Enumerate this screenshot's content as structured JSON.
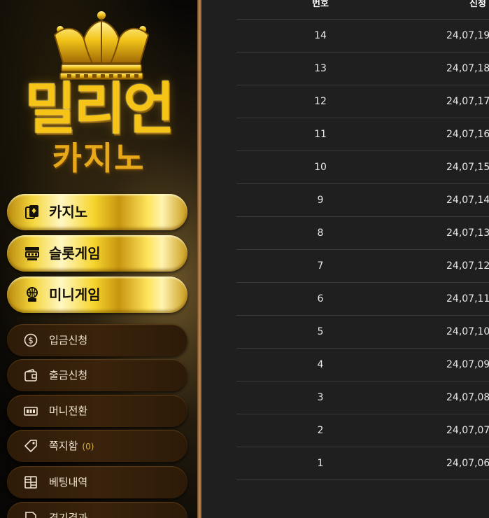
{
  "logo": {
    "main_text": "밀리언",
    "sub_text": "카지노"
  },
  "nav": {
    "gold_items": [
      {
        "label": "카지노",
        "icon": "cards-icon"
      },
      {
        "label": "슬롯게임",
        "icon": "slot-machine-icon"
      },
      {
        "label": "미니게임",
        "icon": "mini-game-icon"
      }
    ],
    "brown_items": [
      {
        "label": "입금신청",
        "icon": "dollar-coin-icon"
      },
      {
        "label": "출금신청",
        "icon": "wallet-icon"
      },
      {
        "label": "머니전환",
        "icon": "money-transfer-icon"
      },
      {
        "label": "쪽지함",
        "count": "(0)",
        "icon": "tag-icon"
      },
      {
        "label": "베팅내역",
        "icon": "grid-calculator-icon"
      },
      {
        "label": "경기결과",
        "icon": "document-icon"
      }
    ]
  },
  "table": {
    "headers": {
      "number": "번호",
      "date": "신청"
    },
    "rows": [
      {
        "number": "14",
        "date": "24,07,19"
      },
      {
        "number": "13",
        "date": "24,07,18"
      },
      {
        "number": "12",
        "date": "24,07,17"
      },
      {
        "number": "11",
        "date": "24,07,16"
      },
      {
        "number": "10",
        "date": "24,07,15"
      },
      {
        "number": "9",
        "date": "24,07,14"
      },
      {
        "number": "8",
        "date": "24,07,13"
      },
      {
        "number": "7",
        "date": "24,07,12"
      },
      {
        "number": "6",
        "date": "24,07,11"
      },
      {
        "number": "5",
        "date": "24,07,10"
      },
      {
        "number": "4",
        "date": "24,07,09"
      },
      {
        "number": "3",
        "date": "24,07,08"
      },
      {
        "number": "2",
        "date": "24,07,07"
      },
      {
        "number": "1",
        "date": "24,07,06"
      }
    ]
  },
  "colors": {
    "gold": "#f5c417",
    "brown_button": "#3a230c",
    "table_bg": "#1f1f1f",
    "count_highlight": "#d9b23a"
  }
}
